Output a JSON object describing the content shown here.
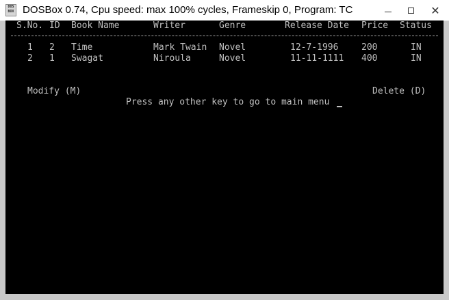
{
  "window": {
    "title": "DOSBox 0.74, Cpu speed: max 100% cycles, Frameskip  0, Program:    TC",
    "icon_text": "DOS BOX",
    "controls": {
      "minimize": "minimize-icon",
      "maximize": "maximize-icon",
      "close": "close-icon"
    }
  },
  "table": {
    "columns": [
      "S.No.",
      "ID",
      "Book Name",
      "Writer",
      "Genre",
      "Release Date",
      "Price",
      "Status"
    ],
    "rows": [
      [
        "1",
        "2",
        "Time",
        "Mark Twain",
        "Novel",
        "12-7-1996",
        "200",
        "IN"
      ],
      [
        "2",
        "1",
        "Swagat",
        "Niroula",
        "Novel",
        "11-11-1111",
        "400",
        "IN"
      ]
    ]
  },
  "actions": {
    "modify": "Modify (M)",
    "delete": "Delete (D)",
    "prompt": "Press any other key to go to main menu"
  },
  "colors": {
    "screen_bg": "#000000",
    "text": "#c0c0c0",
    "titlebar_bg": "#ffffff",
    "frame": "#c9c9c9"
  }
}
